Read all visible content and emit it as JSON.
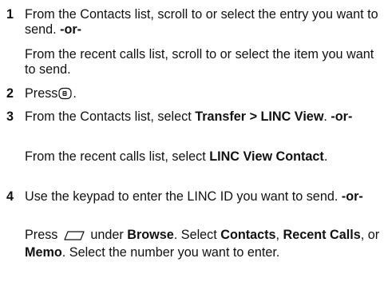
{
  "steps": [
    {
      "number": "1",
      "text_a": "From the Contacts list, scroll to or select the entry you want to send.",
      "or": "-or-",
      "alt_text": "From the recent calls list, scroll to or select the item you want to send."
    },
    {
      "number": "2",
      "text_a": "Press",
      "icon": "menu-key-icon",
      "text_b": "."
    },
    {
      "number": "3",
      "text_a": "From the Contacts list, select",
      "bold_a": "Transfer > LINC View",
      "text_b": ".",
      "or": "-or-",
      "alt_text_a": "From the recent calls list, select",
      "alt_bold": "LINC View Contact",
      "alt_text_b": "."
    },
    {
      "number": "4",
      "text_a": "Use the keypad to enter the LINC ID you want to send.",
      "or": "-or-",
      "alt_text_a": "Press",
      "alt_icon": "softkey-icon",
      "alt_text_b": "under",
      "alt_bold_browse": "Browse",
      "alt_text_c": ". Select",
      "alt_bold_contacts": "Contacts",
      "alt_text_d": ",",
      "alt_bold_recent": "Recent Calls",
      "alt_text_e": ", or",
      "alt_bold_memo": "Memo",
      "alt_text_f": ". Select the number you want to enter."
    }
  ]
}
